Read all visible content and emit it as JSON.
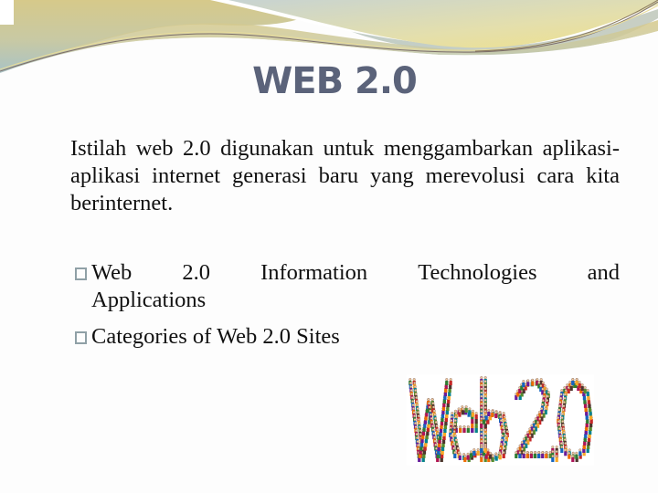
{
  "slide": {
    "title": "WEB 2.0",
    "paragraph": "Istilah web 2.0 digunakan untuk menggambarkan aplikasi-aplikasi internet generasi baru yang merevolusi cara kita berinternet.",
    "bullets": [
      {
        "words": [
          "Web",
          "2.0",
          "Information",
          "Technologies",
          "and"
        ],
        "continuation": "Applications",
        "icon": "placeholder-box-icon"
      },
      {
        "text": "Categories of Web 2.0 Sites",
        "icon": "placeholder-box-icon"
      }
    ],
    "image": {
      "text": "Web 2.0",
      "description": "Web 2.0 lettering formed by crowds of people"
    }
  },
  "colors": {
    "title": "#5b637a",
    "body_text": "#111111",
    "bullet_box": "#8fa0a6",
    "wave_gold": "#d4c98a",
    "wave_blue_gray": "#aec4c6",
    "wave_yellow": "#ecdf8a"
  }
}
